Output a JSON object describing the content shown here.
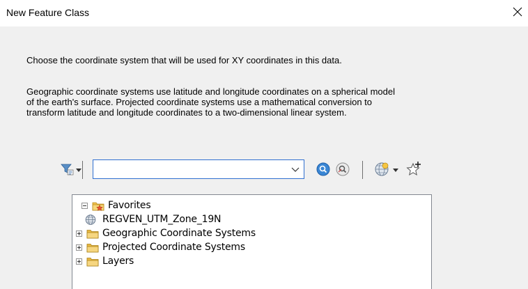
{
  "window": {
    "title": "New Feature Class",
    "close_glyph": "✕"
  },
  "intro": {
    "line1": "Choose the coordinate system that will be used for XY coordinates in this data.",
    "line2": "Geographic coordinate systems use latitude and longitude coordinates on a spherical model\nof the earth's surface. Projected coordinate systems use a mathematical conversion to\ntransform latitude and longitude coordinates to a two-dimensional linear system."
  },
  "toolbar": {
    "filter_icon": "filter-icon",
    "search_value": "",
    "search_icon": "search-icon",
    "clear_search_icon": "clear-search-icon",
    "globe_icon": "globe-icon",
    "add_favorite_icon": "add-favorite-icon"
  },
  "tree": {
    "items": [
      {
        "label": "Favorites",
        "icon": "favorites-folder-icon",
        "expander": "minus",
        "level": 0
      },
      {
        "label": "REGVEN_UTM_Zone_19N",
        "icon": "globe-icon",
        "expander": "none",
        "level": 1
      },
      {
        "label": "Geographic Coordinate Systems",
        "icon": "folder-icon",
        "expander": "plus",
        "level": 0
      },
      {
        "label": "Projected Coordinate Systems",
        "icon": "folder-icon",
        "expander": "plus",
        "level": 0
      },
      {
        "label": "Layers",
        "icon": "folder-icon",
        "expander": "plus",
        "level": 0
      }
    ]
  }
}
